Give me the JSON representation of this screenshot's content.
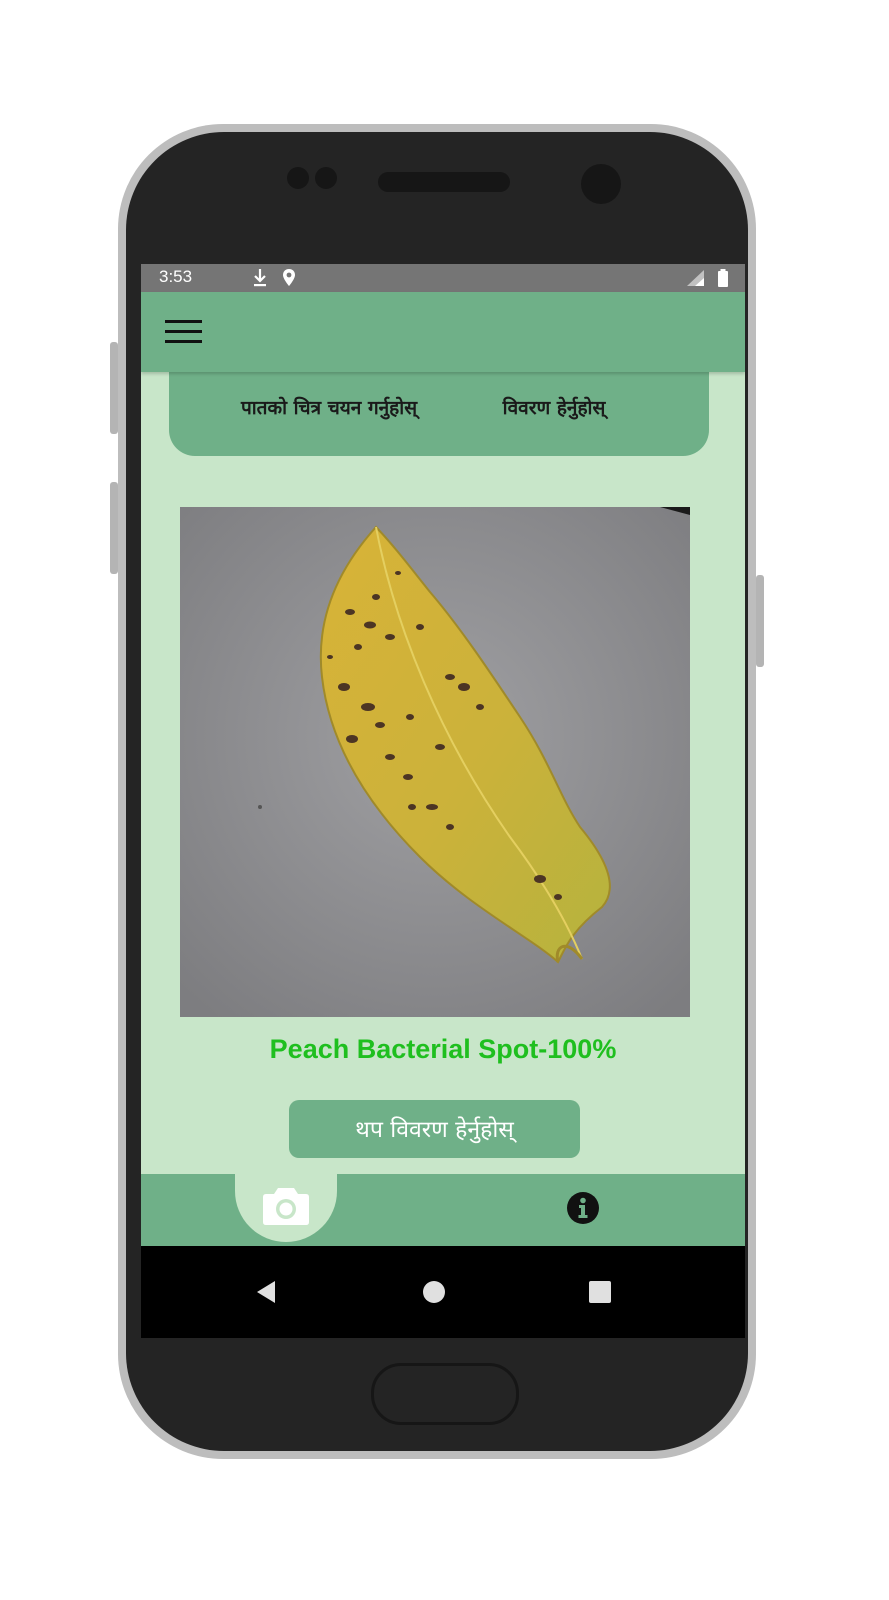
{
  "status_bar": {
    "time": "3:53",
    "left_icons": [
      "download-icon",
      "location-icon"
    ],
    "right_icons": [
      "signal-icon",
      "battery-icon"
    ]
  },
  "app_bar": {
    "menu_icon": "hamburger-menu-icon"
  },
  "actions": {
    "select_image_label": "पातको चित्र चयन गर्नुहोस्",
    "view_details_label": "विवरण हेर्नुहोस्"
  },
  "result": {
    "label": "Peach Bacterial Spot-100%"
  },
  "more_details_button": {
    "label": "थप विवरण हेर्नुहोस्"
  },
  "bottom_nav": {
    "tabs": [
      {
        "icon": "camera-icon",
        "selected": true
      },
      {
        "icon": "info-icon",
        "selected": false
      }
    ]
  },
  "system_nav": [
    "back-icon",
    "home-icon",
    "recents-icon"
  ],
  "colors": {
    "primary": "#6fb088",
    "background": "#c8e6c9",
    "result_text": "#1fbf1f",
    "status_bar": "#757575"
  }
}
